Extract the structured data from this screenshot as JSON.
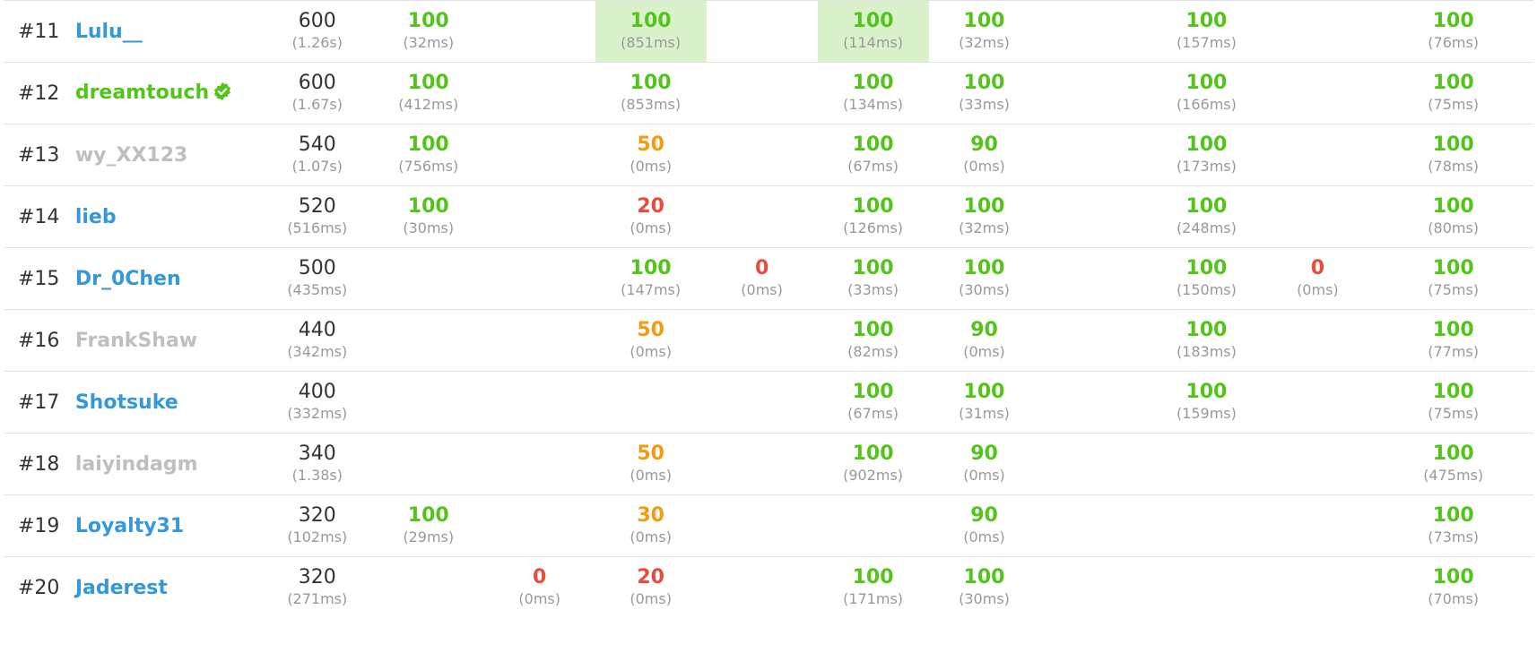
{
  "colors": {
    "accepted": "#52c41a",
    "partial": "#f39c12",
    "low": "#e74c3c",
    "user_blue": "#3498db",
    "user_green": "#52c41a",
    "user_gray": "#bfbfbf",
    "first_solve_bg": "#d9f2cc"
  },
  "rows": [
    {
      "rank": "#11",
      "user": "Lulu__",
      "user_color": "blue",
      "verified": false,
      "total": "600",
      "total_time": "(1.26s)",
      "cells": [
        {
          "score": "100",
          "time": "(32ms)",
          "level": "accepted"
        },
        null,
        {
          "score": "100",
          "time": "(851ms)",
          "level": "accepted",
          "first_solve": true
        },
        null,
        {
          "score": "100",
          "time": "(114ms)",
          "level": "accepted",
          "first_solve": true
        },
        {
          "score": "100",
          "time": "(32ms)",
          "level": "accepted"
        },
        null,
        {
          "score": "100",
          "time": "(157ms)",
          "level": "accepted"
        },
        null,
        {
          "score": "100",
          "time": "(76ms)",
          "level": "accepted"
        }
      ]
    },
    {
      "rank": "#12",
      "user": "dreamtouch",
      "user_color": "green",
      "verified": true,
      "total": "600",
      "total_time": "(1.67s)",
      "cells": [
        {
          "score": "100",
          "time": "(412ms)",
          "level": "accepted"
        },
        null,
        {
          "score": "100",
          "time": "(853ms)",
          "level": "accepted"
        },
        null,
        {
          "score": "100",
          "time": "(134ms)",
          "level": "accepted"
        },
        {
          "score": "100",
          "time": "(33ms)",
          "level": "accepted"
        },
        null,
        {
          "score": "100",
          "time": "(166ms)",
          "level": "accepted"
        },
        null,
        {
          "score": "100",
          "time": "(75ms)",
          "level": "accepted"
        }
      ]
    },
    {
      "rank": "#13",
      "user": "wy_XX123",
      "user_color": "gray",
      "verified": false,
      "total": "540",
      "total_time": "(1.07s)",
      "cells": [
        {
          "score": "100",
          "time": "(756ms)",
          "level": "accepted"
        },
        null,
        {
          "score": "50",
          "time": "(0ms)",
          "level": "partial"
        },
        null,
        {
          "score": "100",
          "time": "(67ms)",
          "level": "accepted"
        },
        {
          "score": "90",
          "time": "(0ms)",
          "level": "accepted"
        },
        null,
        {
          "score": "100",
          "time": "(173ms)",
          "level": "accepted"
        },
        null,
        {
          "score": "100",
          "time": "(78ms)",
          "level": "accepted"
        }
      ]
    },
    {
      "rank": "#14",
      "user": "lieb",
      "user_color": "blue",
      "verified": false,
      "total": "520",
      "total_time": "(516ms)",
      "cells": [
        {
          "score": "100",
          "time": "(30ms)",
          "level": "accepted"
        },
        null,
        {
          "score": "20",
          "time": "(0ms)",
          "level": "low"
        },
        null,
        {
          "score": "100",
          "time": "(126ms)",
          "level": "accepted"
        },
        {
          "score": "100",
          "time": "(32ms)",
          "level": "accepted"
        },
        null,
        {
          "score": "100",
          "time": "(248ms)",
          "level": "accepted"
        },
        null,
        {
          "score": "100",
          "time": "(80ms)",
          "level": "accepted"
        }
      ]
    },
    {
      "rank": "#15",
      "user": "Dr_0Chen",
      "user_color": "blue",
      "verified": false,
      "total": "500",
      "total_time": "(435ms)",
      "cells": [
        null,
        null,
        {
          "score": "100",
          "time": "(147ms)",
          "level": "accepted"
        },
        {
          "score": "0",
          "time": "(0ms)",
          "level": "low"
        },
        {
          "score": "100",
          "time": "(33ms)",
          "level": "accepted"
        },
        {
          "score": "100",
          "time": "(30ms)",
          "level": "accepted"
        },
        null,
        {
          "score": "100",
          "time": "(150ms)",
          "level": "accepted"
        },
        {
          "score": "0",
          "time": "(0ms)",
          "level": "low"
        },
        {
          "score": "100",
          "time": "(75ms)",
          "level": "accepted"
        }
      ]
    },
    {
      "rank": "#16",
      "user": "FrankShaw",
      "user_color": "gray",
      "verified": false,
      "total": "440",
      "total_time": "(342ms)",
      "cells": [
        null,
        null,
        {
          "score": "50",
          "time": "(0ms)",
          "level": "partial"
        },
        null,
        {
          "score": "100",
          "time": "(82ms)",
          "level": "accepted"
        },
        {
          "score": "90",
          "time": "(0ms)",
          "level": "accepted"
        },
        null,
        {
          "score": "100",
          "time": "(183ms)",
          "level": "accepted"
        },
        null,
        {
          "score": "100",
          "time": "(77ms)",
          "level": "accepted"
        }
      ]
    },
    {
      "rank": "#17",
      "user": "Shotsuke",
      "user_color": "blue",
      "verified": false,
      "total": "400",
      "total_time": "(332ms)",
      "cells": [
        null,
        null,
        null,
        null,
        {
          "score": "100",
          "time": "(67ms)",
          "level": "accepted"
        },
        {
          "score": "100",
          "time": "(31ms)",
          "level": "accepted"
        },
        null,
        {
          "score": "100",
          "time": "(159ms)",
          "level": "accepted"
        },
        null,
        {
          "score": "100",
          "time": "(75ms)",
          "level": "accepted"
        }
      ]
    },
    {
      "rank": "#18",
      "user": "laiyindagm",
      "user_color": "gray",
      "verified": false,
      "total": "340",
      "total_time": "(1.38s)",
      "cells": [
        null,
        null,
        {
          "score": "50",
          "time": "(0ms)",
          "level": "partial"
        },
        null,
        {
          "score": "100",
          "time": "(902ms)",
          "level": "accepted"
        },
        {
          "score": "90",
          "time": "(0ms)",
          "level": "accepted"
        },
        null,
        null,
        null,
        {
          "score": "100",
          "time": "(475ms)",
          "level": "accepted"
        }
      ]
    },
    {
      "rank": "#19",
      "user": "Loyalty31",
      "user_color": "blue",
      "verified": false,
      "total": "320",
      "total_time": "(102ms)",
      "cells": [
        {
          "score": "100",
          "time": "(29ms)",
          "level": "accepted"
        },
        null,
        {
          "score": "30",
          "time": "(0ms)",
          "level": "partial"
        },
        null,
        null,
        {
          "score": "90",
          "time": "(0ms)",
          "level": "accepted"
        },
        null,
        null,
        null,
        {
          "score": "100",
          "time": "(73ms)",
          "level": "accepted"
        }
      ]
    },
    {
      "rank": "#20",
      "user": "Jaderest",
      "user_color": "blue",
      "verified": false,
      "total": "320",
      "total_time": "(271ms)",
      "cells": [
        null,
        {
          "score": "0",
          "time": "(0ms)",
          "level": "low"
        },
        {
          "score": "20",
          "time": "(0ms)",
          "level": "low"
        },
        null,
        {
          "score": "100",
          "time": "(171ms)",
          "level": "accepted"
        },
        {
          "score": "100",
          "time": "(30ms)",
          "level": "accepted"
        },
        null,
        null,
        null,
        {
          "score": "100",
          "time": "(70ms)",
          "level": "accepted"
        }
      ]
    }
  ]
}
